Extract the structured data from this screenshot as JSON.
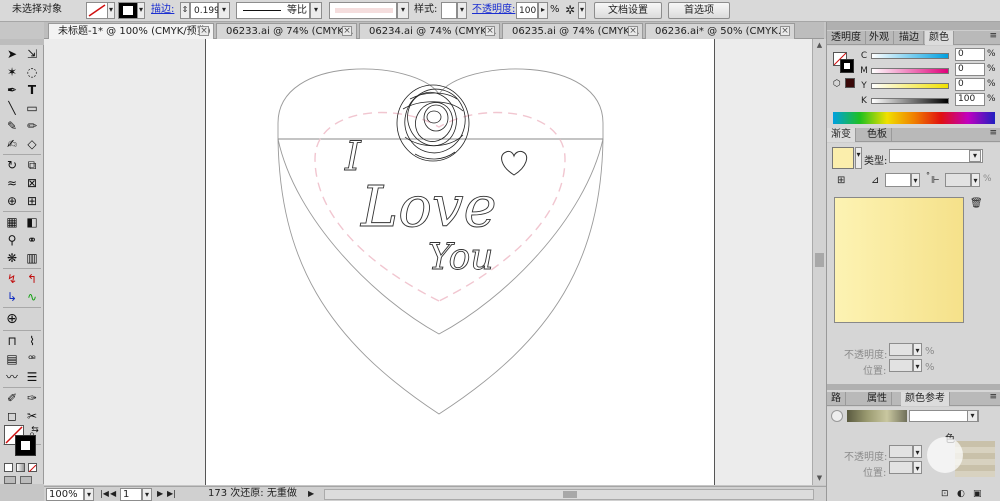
{
  "control": {
    "selection": "未选择对象",
    "stroke_label": "描边:",
    "stroke_value": "0.199",
    "profile_label": "等比",
    "style_label": "样式:",
    "opacity_label": "不透明度:",
    "opacity_value": "100",
    "percent": "%",
    "doc_setup": "文档设置",
    "preferences": "首选项"
  },
  "tabs": [
    {
      "label": "未标题-1* @ 100% (CMYK/预览)"
    },
    {
      "label": "06233.ai @ 74% (CMYK..."
    },
    {
      "label": "06234.ai @ 74% (CMYK..."
    },
    {
      "label": "06235.ai @ 74% (CMYK..."
    },
    {
      "label": "06236.ai* @ 50% (CMYK..."
    }
  ],
  "artwork": {
    "text_i": "I",
    "text_love": "Love",
    "text_you": "You"
  },
  "status": {
    "zoom": "100%",
    "page": "1",
    "info": "173 次还原: 无重做"
  },
  "panels": {
    "tabs_top": [
      {
        "label": "透明度"
      },
      {
        "label": "外观"
      },
      {
        "label": "描边"
      },
      {
        "label": "颜色"
      }
    ],
    "color": {
      "rows": [
        {
          "label": "C",
          "value": "0"
        },
        {
          "label": "M",
          "value": "0"
        },
        {
          "label": "Y",
          "value": "0"
        },
        {
          "label": "K",
          "value": "100"
        }
      ]
    },
    "tabs_mid": [
      {
        "label": "渐变"
      },
      {
        "label": "色板"
      }
    ],
    "gradient": {
      "type_label": "类型:",
      "opacity_label": "不透明度:",
      "location_label": "位置:",
      "percent": "%",
      "swatch_color_a": "#fdf3b3",
      "swatch_color_b": "#f5e18a"
    },
    "tabs_bottom": [
      {
        "label": "路"
      },
      {
        "label": "属性"
      },
      {
        "label": "颜色参考"
      }
    ],
    "bottom": {
      "opacity_label": "不透明度:",
      "location_label": "位置:",
      "color_label": "色"
    }
  }
}
